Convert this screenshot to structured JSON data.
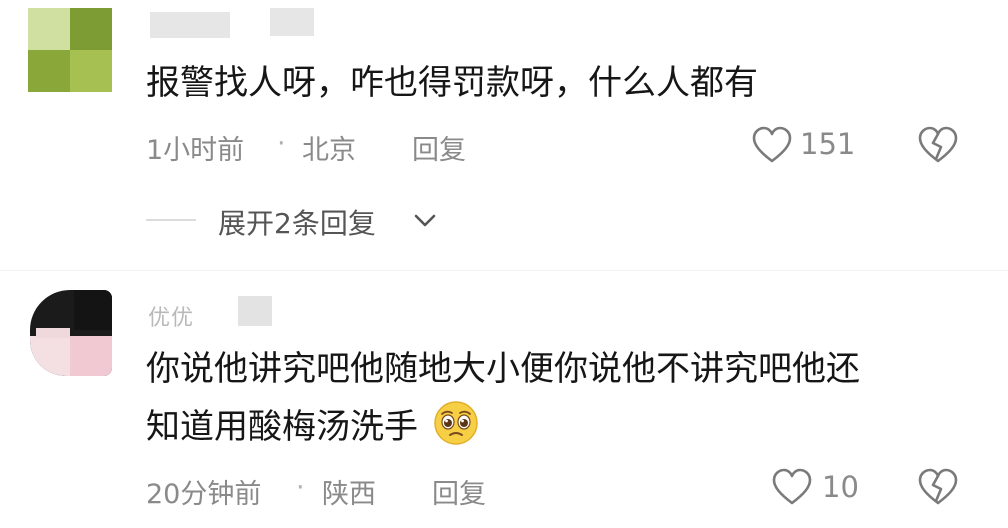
{
  "comments": [
    {
      "username": "",
      "text": "报警找人呀，咋也得罚款呀，什么人都有",
      "time": "1小时前",
      "location": "北京",
      "reply_label": "回复",
      "likes": "151",
      "expand_label": "展开2条回复"
    },
    {
      "username": "优优",
      "text_line1": "你说他讲究吧他随地大小便你说他不讲究吧他还",
      "text_line2": "知道用酸梅汤洗手",
      "emoji": "pleading-face",
      "time": "20分钟前",
      "location": "陕西",
      "reply_label": "回复",
      "likes": "10"
    }
  ],
  "separator": "·",
  "icons": {
    "like": "heart-outline-icon",
    "dislike": "broken-heart-icon",
    "expand": "chevron-down-icon"
  },
  "colors": {
    "text_primary": "#161616",
    "text_secondary": "#8a8a8a",
    "background": "#ffffff",
    "avatar1_green": "#8aa83a",
    "avatar2_black": "#1b1b1b"
  }
}
